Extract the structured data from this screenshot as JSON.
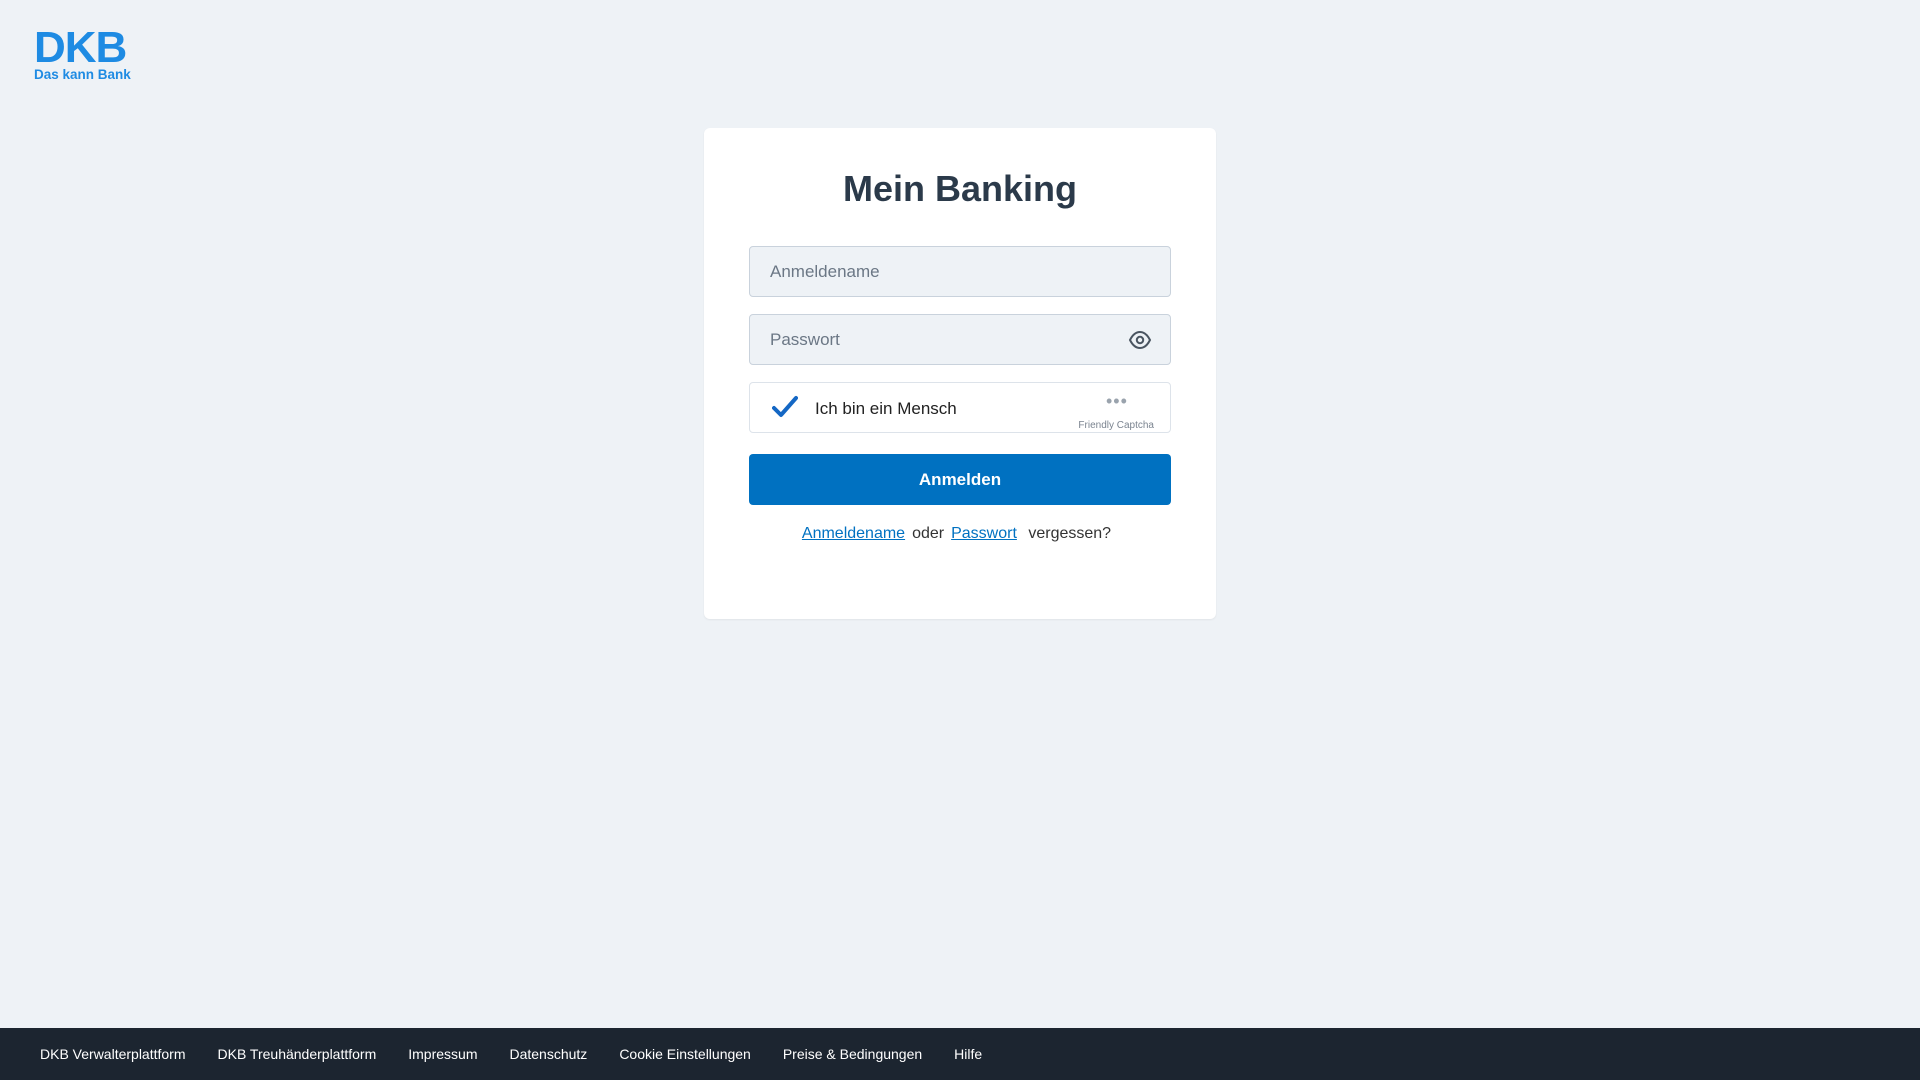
{
  "logo": {
    "brand": "DKB",
    "slogan": "Das kann Bank",
    "color": "#1e8be3"
  },
  "login": {
    "title": "Mein Banking",
    "username_placeholder": "Anmeldename",
    "password_placeholder": "Passwort",
    "captcha_label": "Ich bin ein Mensch",
    "captcha_brand": "Friendly Captcha",
    "captcha_checked": true,
    "submit_label": "Anmelden",
    "forgot": {
      "username_link": "Anmeldename",
      "or": "oder",
      "password_link": "Passwort",
      "suffix": "vergessen?"
    }
  },
  "footer": {
    "links": [
      "DKB Verwalterplattform",
      "DKB Treuhänderplattform",
      "Impressum",
      "Datenschutz",
      "Cookie Einstellungen",
      "Preise & Bedingungen",
      "Hilfe"
    ]
  },
  "colors": {
    "accent": "#0071c1",
    "background": "#eef2f6",
    "footer": "#1c2530"
  },
  "icons": {
    "password_toggle": "eye-icon",
    "captcha_status": "checkmark-icon"
  }
}
